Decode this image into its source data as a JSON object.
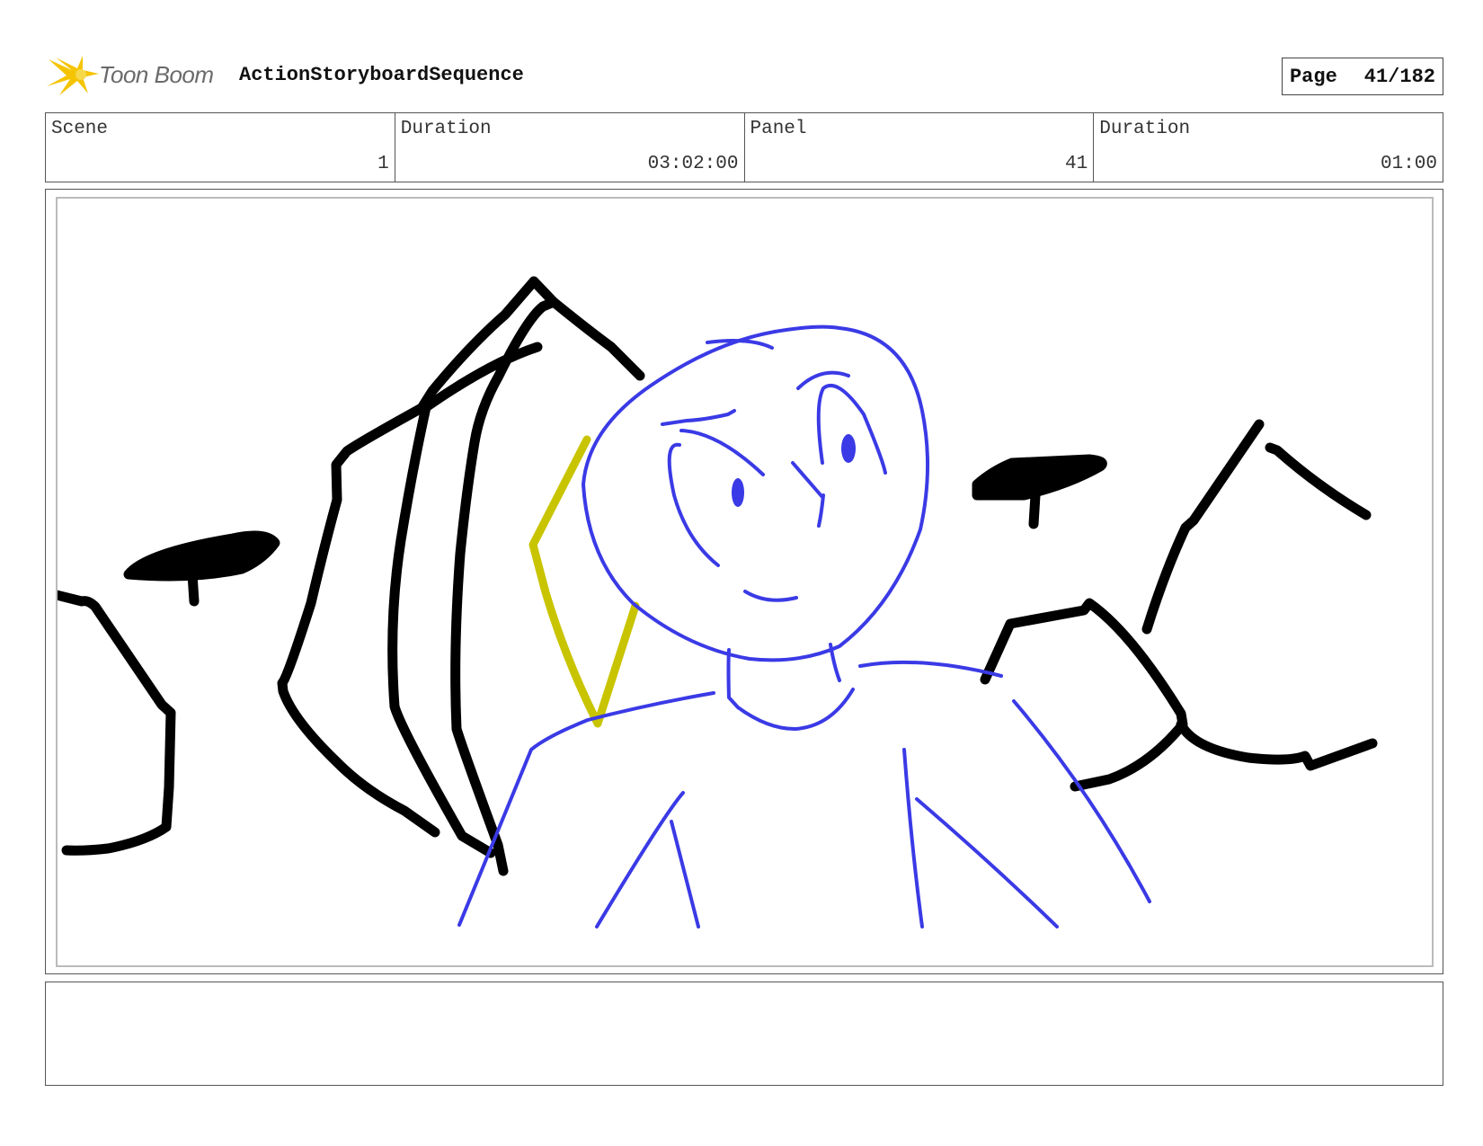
{
  "header": {
    "logo_text": "Toon Boom",
    "project_title": "ActionStoryboardSequence",
    "page_label": "Page",
    "page_number": "41/182"
  },
  "info": {
    "scene_label": "Scene",
    "scene_value": "1",
    "scene_duration_label": "Duration",
    "scene_duration_value": "03:02:00",
    "panel_label": "Panel",
    "panel_value": "41",
    "panel_duration_label": "Duration",
    "panel_duration_value": "01:00"
  },
  "colors": {
    "sketch_black": "#000000",
    "sketch_blue": "#3a3ae6",
    "sketch_yellow": "#c9c400",
    "logo_yellow": "#f5c400"
  },
  "notes": {
    "text": ""
  }
}
